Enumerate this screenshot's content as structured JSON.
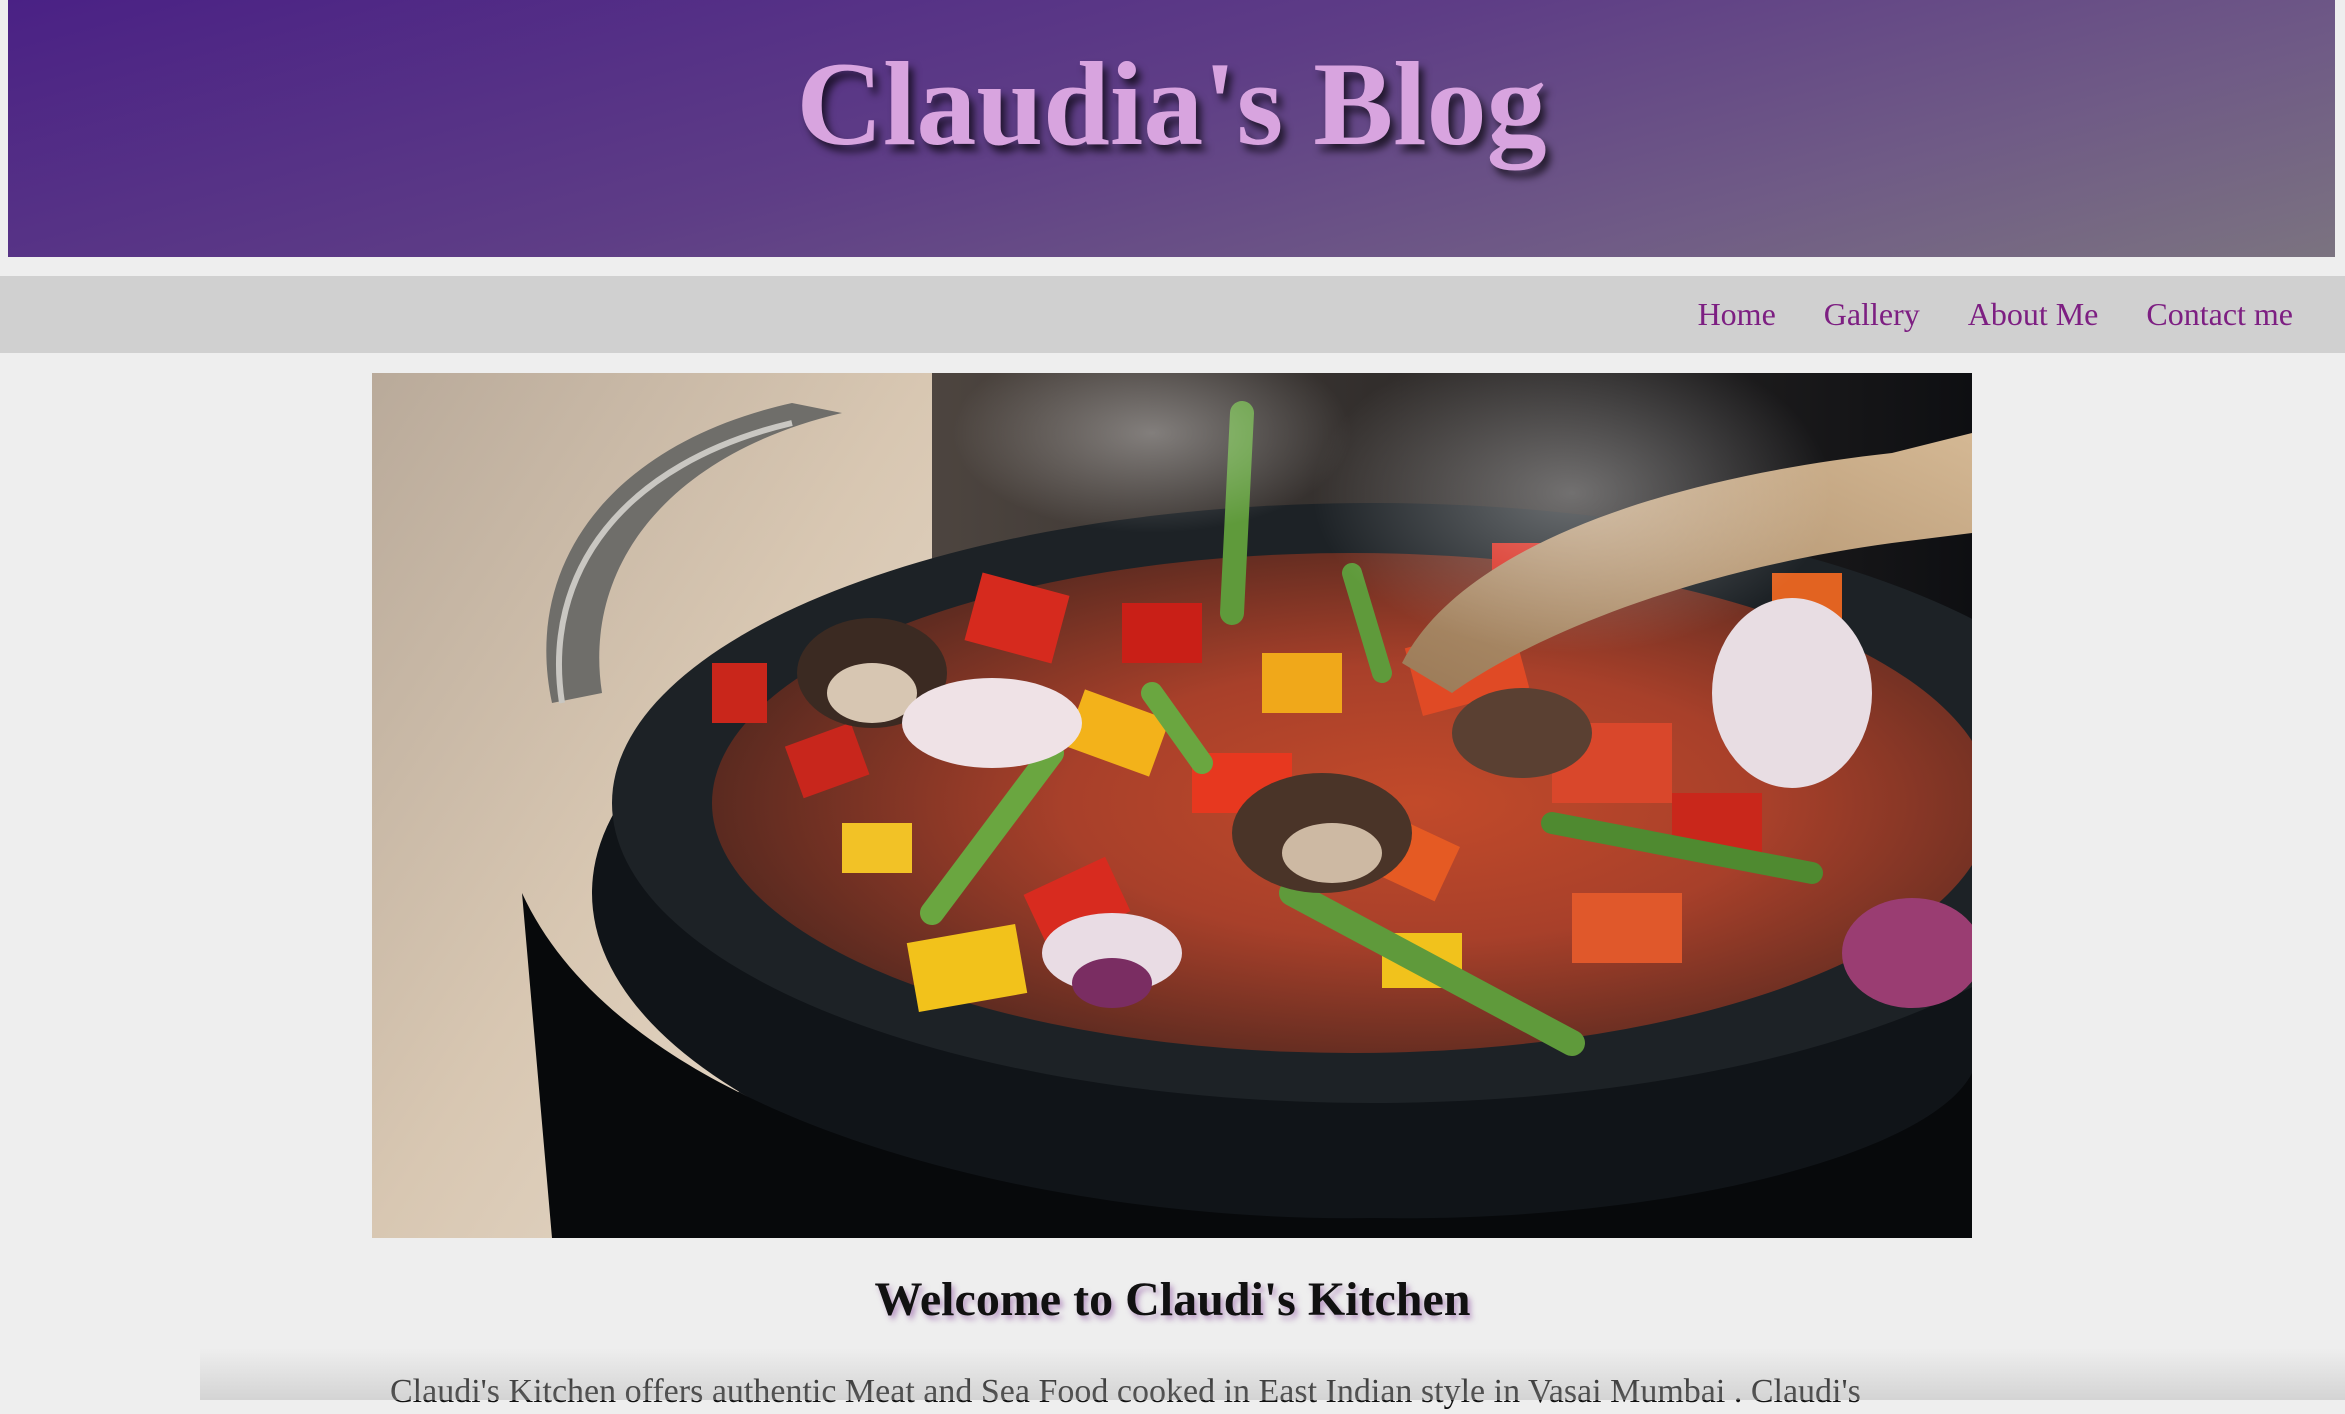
{
  "header": {
    "title": "Claudia's Blog"
  },
  "nav": {
    "items": [
      {
        "label": "Home"
      },
      {
        "label": "Gallery"
      },
      {
        "label": "About Me"
      },
      {
        "label": "Contact me"
      }
    ]
  },
  "hero": {
    "image_subject": "stir-fried vegetables in a black wok with a wooden spoon"
  },
  "main": {
    "heading": "Welcome to Claudi's Kitchen",
    "intro": "Claudi's Kitchen offers authentic Meat and Sea Food cooked in East Indian style in Vasai Mumbai . Claudi's"
  },
  "colors": {
    "nav_link": "#7d1f82",
    "title": "#d8a4df",
    "header_start": "#4a2185",
    "header_end": "#7b7380"
  }
}
